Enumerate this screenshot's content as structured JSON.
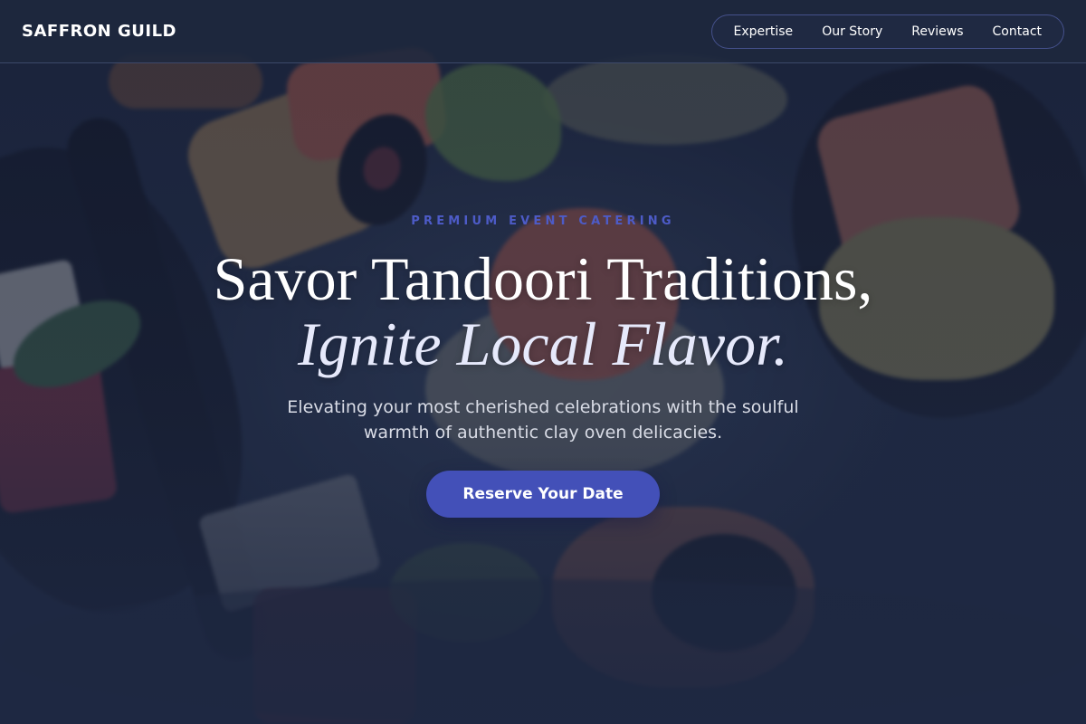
{
  "brand": {
    "name": "SAFFRON GUILD"
  },
  "nav": {
    "items": [
      {
        "label": "Expertise"
      },
      {
        "label": "Our Story"
      },
      {
        "label": "Reviews"
      },
      {
        "label": "Contact"
      }
    ]
  },
  "hero": {
    "eyebrow": "PREMIUM EVENT CATERING",
    "headline_line1": "Savor Tandoori Traditions,",
    "headline_line2": "Ignite Local Flavor.",
    "subtext": "Elevating your most cherished celebrations with the soulful warmth of authentic clay oven delicacies.",
    "cta_label": "Reserve Your Date",
    "background_image": "catered-appetizers-photo"
  },
  "colors": {
    "navbar_bg": "#1e283e",
    "accent": "#4350b8",
    "eyebrow": "#4d5bc7",
    "text": "#ffffff",
    "subtext": "#d9dce6"
  }
}
